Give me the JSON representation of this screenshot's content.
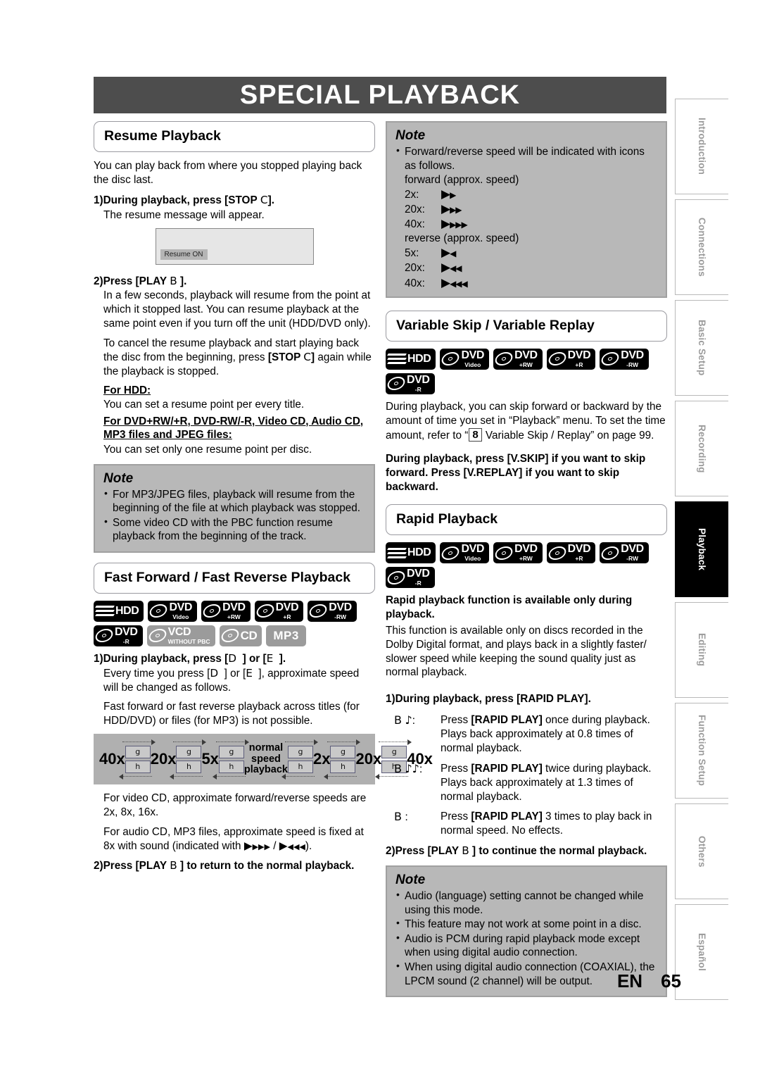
{
  "page": {
    "title": "SPECIAL PLAYBACK",
    "footer_lang": "EN",
    "footer_page": "65",
    "accent_header_bg": "#4d4d4d",
    "note_bg": "#b8b8b8",
    "active_tab_bg": "#000000"
  },
  "sidebar": {
    "tabs": [
      {
        "label": "Introduction",
        "active": false
      },
      {
        "label": "Connections",
        "active": false
      },
      {
        "label": "Basic Setup",
        "active": false
      },
      {
        "label": "Recording",
        "active": false
      },
      {
        "label": "Playback",
        "active": true
      },
      {
        "label": "Editing",
        "active": false
      },
      {
        "label": "Function Setup",
        "active": false
      },
      {
        "label": "Others",
        "active": false
      },
      {
        "label": "Español",
        "active": false
      }
    ]
  },
  "resume": {
    "heading": "Resume Playback",
    "intro": "You can play back from where you stopped playing back the disc last.",
    "step1": "1)During playback, press [STOP C].",
    "step1_body": "The resume message will appear.",
    "screenshot_message": "Resume ON",
    "step2": "2)Press [PLAY B ].",
    "step2_body1": "In a few seconds, playback will resume from the point at which it stopped last. You can resume playback at the same point even if you turn off the unit (HDD/DVD only).",
    "step2_body2": "To cancel the resume playback and start playing back the disc from the beginning, press [STOP C] again while the playback is stopped.",
    "for_hdd_label": "For HDD:",
    "for_hdd_body": "You can set a resume point per every title.",
    "for_dvd_label": "For DVD+RW/+R, DVD-RW/-R, Video CD, Audio CD, MP3 files and JPEG files:",
    "for_dvd_body": "You can set only one resume point per disc.",
    "note": {
      "title": "Note",
      "items": [
        "For MP3/JPEG files, playback will resume from the beginning of the file at which playback was stopped.",
        "Some video CD with the PBC function resume playback from the beginning of the track."
      ]
    }
  },
  "fast_forward": {
    "heading": "Fast Forward / Fast Reverse Playback",
    "badges": [
      {
        "main": "HDD",
        "sub": "",
        "style": "hdd"
      },
      {
        "main": "DVD",
        "sub": "Video",
        "style": "black"
      },
      {
        "main": "DVD",
        "sub": "+RW",
        "style": "black"
      },
      {
        "main": "DVD",
        "sub": "+R",
        "style": "black"
      },
      {
        "main": "DVD",
        "sub": "-RW",
        "style": "black"
      },
      {
        "main": "DVD",
        "sub": "-R",
        "style": "black"
      },
      {
        "main": "VCD",
        "sub": "WITHOUT PBC",
        "style": "gray"
      },
      {
        "main": "CD",
        "sub": "",
        "style": "gray"
      },
      {
        "main": "MP3",
        "sub": "",
        "style": "gray-plain"
      }
    ],
    "step1": "1)During playback, press [D ] or [E ].",
    "step1_body1": "Every time you press [D ] or [E ], approximate speed will be changed as follows.",
    "step1_body2": "Fast forward or fast reverse playback across titles (for HDD/DVD) or files (for MP3) is not possible.",
    "speed_figure": {
      "left_speeds": [
        "40x",
        "20x",
        "5x"
      ],
      "center_label": "normal speed playback",
      "right_speeds": [
        "2x",
        "20x",
        "40x"
      ],
      "cell_top": "g",
      "cell_bottom": "h"
    },
    "body_video_cd": "For video CD, approximate forward/reverse speeds are 2x, 8x, 16x.",
    "body_audio_cd_pre": "For audio CD, MP3 files, approximate speed is fixed at 8x with sound (indicated with ",
    "body_audio_cd_post": ").",
    "step2": "2)Press [PLAY B ] to return to the normal playback."
  },
  "note_speed": {
    "title": "Note",
    "bullet": "Forward/reverse speed will be indicated with icons as follows.",
    "forward_label": "forward (approx. speed)",
    "forward_rows": [
      {
        "speed": "2x:",
        "arrows": 1
      },
      {
        "speed": "20x:",
        "arrows": 2
      },
      {
        "speed": "40x:",
        "arrows": 3
      }
    ],
    "reverse_label": "reverse (approx. speed)",
    "reverse_rows": [
      {
        "speed": "5x:",
        "arrows": 1
      },
      {
        "speed": "20x:",
        "arrows": 2
      },
      {
        "speed": "40x:",
        "arrows": 3
      }
    ]
  },
  "variable_skip": {
    "heading": "Variable Skip / Variable Replay",
    "badges": [
      {
        "main": "HDD",
        "sub": "",
        "style": "hdd"
      },
      {
        "main": "DVD",
        "sub": "Video",
        "style": "black"
      },
      {
        "main": "DVD",
        "sub": "+RW",
        "style": "black"
      },
      {
        "main": "DVD",
        "sub": "+R",
        "style": "black"
      },
      {
        "main": "DVD",
        "sub": "-RW",
        "style": "black"
      },
      {
        "main": "DVD",
        "sub": "-R",
        "style": "black"
      }
    ],
    "body_pre": "During playback, you can skip forward or backward by the amount of time you set in “Playback” menu. To set the time amount, refer to “",
    "boxnum": "8",
    "body_post": " Variable Skip / Replay” on page 99.",
    "instruction": "During playback, press [V.SKIP] if you want to skip forward. Press [V.REPLAY] if you want to skip backward."
  },
  "rapid_playback": {
    "heading": "Rapid Playback",
    "badges": [
      {
        "main": "HDD",
        "sub": "",
        "style": "hdd"
      },
      {
        "main": "DVD",
        "sub": "Video",
        "style": "black"
      },
      {
        "main": "DVD",
        "sub": "+RW",
        "style": "black"
      },
      {
        "main": "DVD",
        "sub": "+R",
        "style": "black"
      },
      {
        "main": "DVD",
        "sub": "-RW",
        "style": "black"
      },
      {
        "main": "DVD",
        "sub": "-R",
        "style": "black"
      }
    ],
    "lead_bold": "Rapid playback function is available only during playback.",
    "lead_body": "This function is available only on discs recorded in the Dolby Digital format, and plays back in a slightly faster/ slower speed while keeping the sound quality just as normal playback.",
    "step1": "1)During playback, press [RAPID PLAY].",
    "rows": [
      {
        "key": "B ♪:",
        "text": "Press [RAPID PLAY] once during playback. Plays back approximately at 0.8 times of normal playback."
      },
      {
        "key": "B ♪♪:",
        "text": "Press [RAPID PLAY] twice during playback. Plays back approximately at 1.3 times of normal playback."
      },
      {
        "key": "B :",
        "text": "Press [RAPID PLAY] 3 times to play back in normal speed. No effects."
      }
    ],
    "step2": "2)Press [PLAY B ] to continue the normal playback.",
    "note": {
      "title": "Note",
      "items": [
        "Audio (language) setting cannot be changed while using this mode.",
        "This feature may not work at some point in a disc.",
        "Audio is PCM during rapid playback mode except when using digital audio connection.",
        "When using digital audio connection (COAXIAL), the LPCM sound (2 channel) will be output."
      ]
    }
  }
}
